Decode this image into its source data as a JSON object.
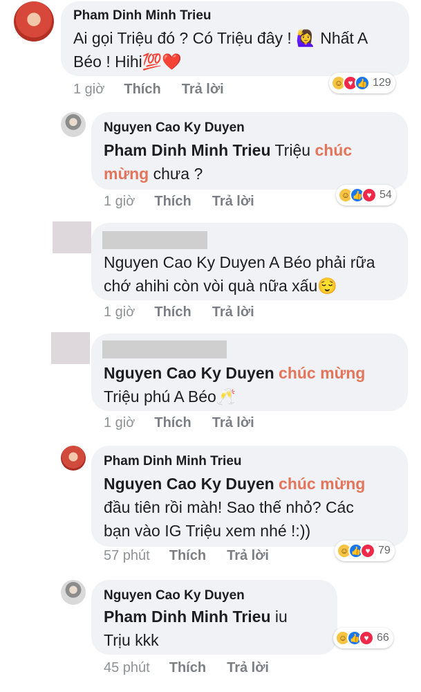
{
  "comments": [
    {
      "author": "Pham Dinh Minh Trieu",
      "text_1": "Ai gọi Triệu đó ? Có Triệu đây !",
      "emoji_1": "🙋‍♀️",
      "text_2": "Nhất A",
      "text_3": "Béo ! Hihi",
      "emoji_2": "💯❤️",
      "time": "1 giờ",
      "like": "Thích",
      "reply": "Trả lời",
      "reactions": [
        "haha",
        "love",
        "like"
      ],
      "reaction_count": "129"
    },
    {
      "author": "Nguyen Cao Ky Duyen",
      "mention": "Pham Dinh Minh Trieu",
      "text_1": " Triệu ",
      "highlight_1": "chúc",
      "highlight_2": "mừng",
      "text_2": " chưa ?",
      "time": "1 giờ",
      "like": "Thích",
      "reply": "Trả lời",
      "reactions": [
        "haha",
        "like",
        "love"
      ],
      "reaction_count": "54"
    },
    {
      "author": "",
      "text_1": "Nguyen Cao Ky Duyen A Béo phải rữa",
      "text_2": "chớ ahihi còn vòi quà nữa xấu",
      "emoji_1": "😌",
      "time": "1 giờ",
      "like": "Thích",
      "reply": "Trả lời"
    },
    {
      "author": "",
      "mention": "Nguyen Cao Ky Duyen",
      "highlight_1": "chúc mừng",
      "text_1": "Triệu phú A Béo",
      "emoji_1": "🥂",
      "time": "1 giờ",
      "like": "Thích",
      "reply": "Trả lời"
    },
    {
      "author": "Pham Dinh Minh Trieu",
      "mention": "Nguyen Cao Ky Duyen",
      "highlight_1": "chúc mừng",
      "text_1": "đầu tiên rồi màh! Sao thế nhỏ? Các",
      "text_2": "bạn vào IG Triệu xem nhé !:))",
      "time": "57 phút",
      "like": "Thích",
      "reply": "Trả lời",
      "reactions": [
        "haha",
        "like",
        "love"
      ],
      "reaction_count": "79"
    },
    {
      "author": "Nguyen Cao Ky Duyen",
      "mention": "Pham Dinh Minh Trieu",
      "text_1": " iu",
      "text_2": "Trịu kkk",
      "time": "45 phút",
      "like": "Thích",
      "reply": "Trả lời",
      "reactions": [
        "haha",
        "like",
        "love"
      ],
      "reaction_count": "66"
    }
  ],
  "colors": {
    "bubble": "#f0f2f5",
    "highlight": "#e4745a",
    "meta": "#8e9196"
  }
}
